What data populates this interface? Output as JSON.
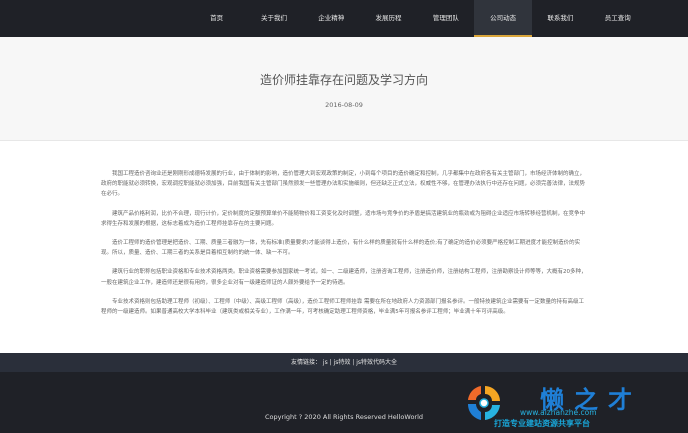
{
  "nav": {
    "items": [
      {
        "label": "首页"
      },
      {
        "label": "关于我们"
      },
      {
        "label": "企业精神"
      },
      {
        "label": "发展历程"
      },
      {
        "label": "管理团队"
      },
      {
        "label": "公司动态"
      },
      {
        "label": "联系我们"
      },
      {
        "label": "员工查询"
      }
    ],
    "active": "公司动态"
  },
  "article": {
    "title": "造价师挂靠存在问题及学习方向",
    "date": "2016-08-09",
    "paragraphs": [
      "我国工程造价咨询业还是刚刚形成德特发展的行业，由于体制的影响，造价管理大到宏观政策的制定，小到每个项目的造价确定和控制，几乎都集中在政府各有关主管部门，市场经济体制的确立，政府的职能就必须转换，宏观调控职能就必须加强，目前我国有关主管部门虽然颁发一些管理办法和实施细则，但还缺乏正式立法，权威性不够，在管理办法执行中还存在问题，必须完善法律，法规势在必行。",
      "建筑产品价格利润，比价不合理，现行计价，定价制度的定额预算单价不能随物价和工资变化及时调整，适市场与竞争价的矛盾是搞活建筑业的瓶劲或为阻碍企业适应市场转移经营机制，在竞争中求得生存和发展的根据，这标志着成为造价工程师挂靠存在的主要问题。",
      "造价工程师的造价管理是把造价、工期、质量三者融为一体，先有标准(质量要求)才能谈得上造价，有什么样的质量就有什么样的造价;有了确定的造价必须要严格控制工期进度才能控制造价的实现。所以，质量、造价、工期三者的关系是目着相互制约的统一体、缺一不可。",
      "建筑行业的职称包括职业资格和专业技术资格两类。职业资格需要参加国家统一考试，如一、二级建造师，注册咨询工程师，注册造价师，注册结构工程师，注册勘察设计师等等，大概有20多种，一般在建筑企业工作，建造师还是很有用的，很多企业对有一级建造师证的人颇外要给予一定的待遇。",
      "专业技术资格则包括助理工程师（初级）、工程师（中级）、高级工程师（高级），造价工程师工程师挂靠 需要在所在地政府人力资源部门报名参评。一般特技建筑企业需要有一定数量的持有高级工程师的一级建造师。如果普通高校大学本科毕业（建筑类或相关专业），工作满一年，可考核确定助理工程师资格，毕业满5年可报名参评工程师；毕业满十年可评高级。"
    ]
  },
  "footer": {
    "links_label": "友情链接：",
    "links": [
      "js",
      "js特效",
      "js特效代码大全"
    ],
    "separator": " | ",
    "copyright": "Copyright ? 2020 All Rights Reserved HelloWorld"
  },
  "watermark": {
    "brand": "懒之才",
    "url": "www.aizhanzhe.com",
    "slogan": "打造专业建站资源共享平台"
  },
  "colors": {
    "nav_bg": "#1f2127",
    "nav_active_bg": "#30343c",
    "nav_active_underline": "#d9a53a",
    "footer_links_bg": "#2a2f3a",
    "watermark_blue": "#1f7fd6"
  }
}
